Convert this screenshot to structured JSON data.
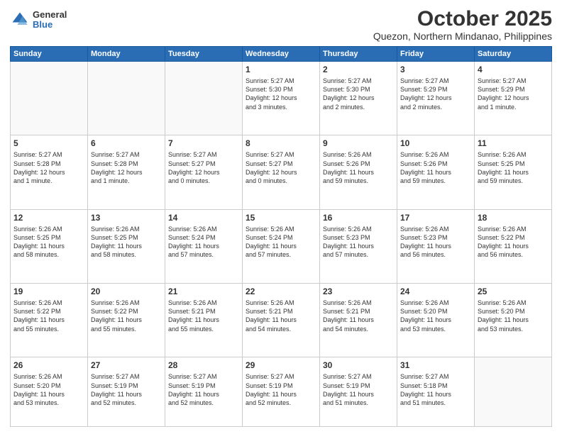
{
  "header": {
    "logo_general": "General",
    "logo_blue": "Blue",
    "month_title": "October 2025",
    "subtitle": "Quezon, Northern Mindanao, Philippines"
  },
  "days_of_week": [
    "Sunday",
    "Monday",
    "Tuesday",
    "Wednesday",
    "Thursday",
    "Friday",
    "Saturday"
  ],
  "weeks": [
    [
      {
        "day": "",
        "content": ""
      },
      {
        "day": "",
        "content": ""
      },
      {
        "day": "",
        "content": ""
      },
      {
        "day": "1",
        "content": "Sunrise: 5:27 AM\nSunset: 5:30 PM\nDaylight: 12 hours\nand 3 minutes."
      },
      {
        "day": "2",
        "content": "Sunrise: 5:27 AM\nSunset: 5:30 PM\nDaylight: 12 hours\nand 2 minutes."
      },
      {
        "day": "3",
        "content": "Sunrise: 5:27 AM\nSunset: 5:29 PM\nDaylight: 12 hours\nand 2 minutes."
      },
      {
        "day": "4",
        "content": "Sunrise: 5:27 AM\nSunset: 5:29 PM\nDaylight: 12 hours\nand 1 minute."
      }
    ],
    [
      {
        "day": "5",
        "content": "Sunrise: 5:27 AM\nSunset: 5:28 PM\nDaylight: 12 hours\nand 1 minute."
      },
      {
        "day": "6",
        "content": "Sunrise: 5:27 AM\nSunset: 5:28 PM\nDaylight: 12 hours\nand 1 minute."
      },
      {
        "day": "7",
        "content": "Sunrise: 5:27 AM\nSunset: 5:27 PM\nDaylight: 12 hours\nand 0 minutes."
      },
      {
        "day": "8",
        "content": "Sunrise: 5:27 AM\nSunset: 5:27 PM\nDaylight: 12 hours\nand 0 minutes."
      },
      {
        "day": "9",
        "content": "Sunrise: 5:26 AM\nSunset: 5:26 PM\nDaylight: 11 hours\nand 59 minutes."
      },
      {
        "day": "10",
        "content": "Sunrise: 5:26 AM\nSunset: 5:26 PM\nDaylight: 11 hours\nand 59 minutes."
      },
      {
        "day": "11",
        "content": "Sunrise: 5:26 AM\nSunset: 5:25 PM\nDaylight: 11 hours\nand 59 minutes."
      }
    ],
    [
      {
        "day": "12",
        "content": "Sunrise: 5:26 AM\nSunset: 5:25 PM\nDaylight: 11 hours\nand 58 minutes."
      },
      {
        "day": "13",
        "content": "Sunrise: 5:26 AM\nSunset: 5:25 PM\nDaylight: 11 hours\nand 58 minutes."
      },
      {
        "day": "14",
        "content": "Sunrise: 5:26 AM\nSunset: 5:24 PM\nDaylight: 11 hours\nand 57 minutes."
      },
      {
        "day": "15",
        "content": "Sunrise: 5:26 AM\nSunset: 5:24 PM\nDaylight: 11 hours\nand 57 minutes."
      },
      {
        "day": "16",
        "content": "Sunrise: 5:26 AM\nSunset: 5:23 PM\nDaylight: 11 hours\nand 57 minutes."
      },
      {
        "day": "17",
        "content": "Sunrise: 5:26 AM\nSunset: 5:23 PM\nDaylight: 11 hours\nand 56 minutes."
      },
      {
        "day": "18",
        "content": "Sunrise: 5:26 AM\nSunset: 5:22 PM\nDaylight: 11 hours\nand 56 minutes."
      }
    ],
    [
      {
        "day": "19",
        "content": "Sunrise: 5:26 AM\nSunset: 5:22 PM\nDaylight: 11 hours\nand 55 minutes."
      },
      {
        "day": "20",
        "content": "Sunrise: 5:26 AM\nSunset: 5:22 PM\nDaylight: 11 hours\nand 55 minutes."
      },
      {
        "day": "21",
        "content": "Sunrise: 5:26 AM\nSunset: 5:21 PM\nDaylight: 11 hours\nand 55 minutes."
      },
      {
        "day": "22",
        "content": "Sunrise: 5:26 AM\nSunset: 5:21 PM\nDaylight: 11 hours\nand 54 minutes."
      },
      {
        "day": "23",
        "content": "Sunrise: 5:26 AM\nSunset: 5:21 PM\nDaylight: 11 hours\nand 54 minutes."
      },
      {
        "day": "24",
        "content": "Sunrise: 5:26 AM\nSunset: 5:20 PM\nDaylight: 11 hours\nand 53 minutes."
      },
      {
        "day": "25",
        "content": "Sunrise: 5:26 AM\nSunset: 5:20 PM\nDaylight: 11 hours\nand 53 minutes."
      }
    ],
    [
      {
        "day": "26",
        "content": "Sunrise: 5:26 AM\nSunset: 5:20 PM\nDaylight: 11 hours\nand 53 minutes."
      },
      {
        "day": "27",
        "content": "Sunrise: 5:27 AM\nSunset: 5:19 PM\nDaylight: 11 hours\nand 52 minutes."
      },
      {
        "day": "28",
        "content": "Sunrise: 5:27 AM\nSunset: 5:19 PM\nDaylight: 11 hours\nand 52 minutes."
      },
      {
        "day": "29",
        "content": "Sunrise: 5:27 AM\nSunset: 5:19 PM\nDaylight: 11 hours\nand 52 minutes."
      },
      {
        "day": "30",
        "content": "Sunrise: 5:27 AM\nSunset: 5:19 PM\nDaylight: 11 hours\nand 51 minutes."
      },
      {
        "day": "31",
        "content": "Sunrise: 5:27 AM\nSunset: 5:18 PM\nDaylight: 11 hours\nand 51 minutes."
      },
      {
        "day": "",
        "content": ""
      }
    ]
  ]
}
